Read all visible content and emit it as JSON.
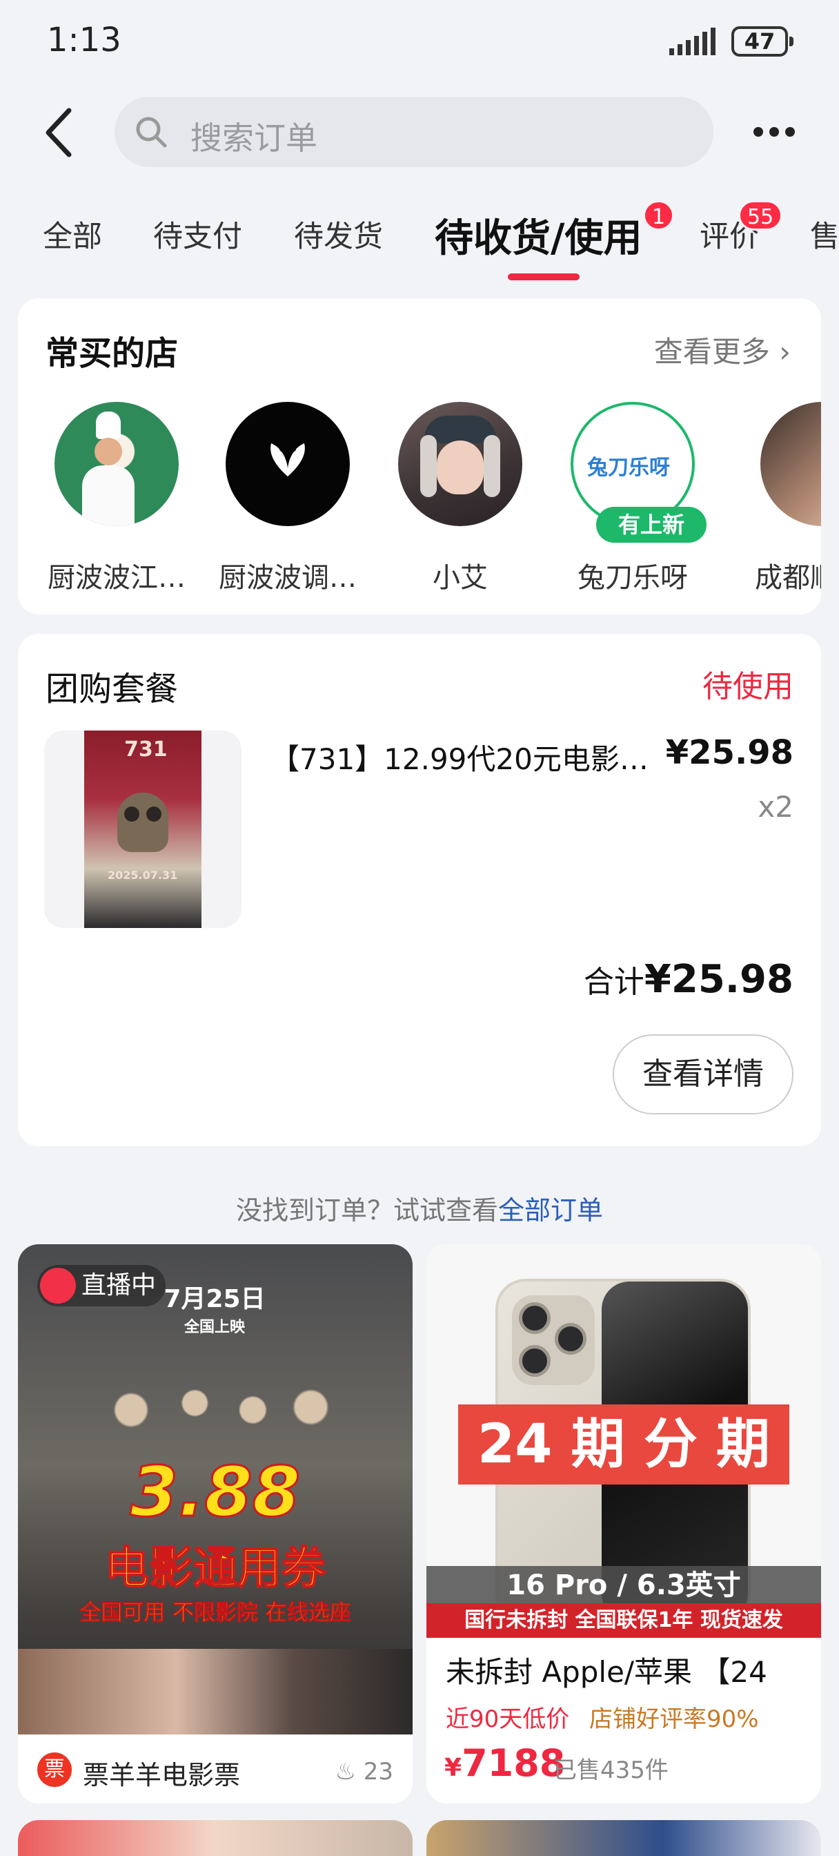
{
  "status_bar": {
    "time": "1:13",
    "battery": "47"
  },
  "search": {
    "placeholder": "搜索订单"
  },
  "tabs": [
    {
      "label": "全部"
    },
    {
      "label": "待支付"
    },
    {
      "label": "待发货"
    },
    {
      "label": "待收货/使用",
      "badge": "1",
      "active": true
    },
    {
      "label": "评价",
      "badge": "55"
    },
    {
      "label": "售"
    }
  ],
  "frequent_shops": {
    "title": "常买的店",
    "see_more": "查看更多",
    "shops": [
      {
        "name": "厨波波江…"
      },
      {
        "name": "厨波波调…"
      },
      {
        "name": "小艾"
      },
      {
        "name": "兔刀乐呀",
        "tag": "有上新",
        "logo_text": "兔刀乐呀"
      },
      {
        "name": "成都顺"
      }
    ]
  },
  "order": {
    "category": "团购套餐",
    "status": "待使用",
    "product_title": "【731】12.99代20元电影…",
    "price": "¥25.98",
    "quantity": "x2",
    "total_label": "合计",
    "total_value": "¥25.98",
    "detail_button": "查看详情",
    "poster_text": "731",
    "poster_date": "2025.07.31"
  },
  "hint": {
    "text": "没找到订单？试试查看",
    "link": "全部订单"
  },
  "feed": [
    {
      "live_label": "直播中",
      "poster_top": "7月25日",
      "poster_sub": "全国上映",
      "poster_big": "3.88",
      "poster_main": "电影通用券",
      "poster_note": "全国可用 不限影院 在线选座",
      "shop": "票羊羊电影票",
      "shop_icon": "票",
      "hot": "23"
    },
    {
      "banner": "24 期 分 期",
      "model": "16 Pro / 6.3英寸",
      "strip": "国行未拆封 全国联保1年 现货速发",
      "title": "未拆封 Apple/苹果 【24",
      "tag1": "近90天低价",
      "tag2": "店铺好评率90%",
      "price_symbol": "¥",
      "price": "7188",
      "sold": "已售435件"
    }
  ],
  "colors": {
    "accent": "#ee2840",
    "link": "#2b5fb8",
    "green": "#1db86a"
  }
}
